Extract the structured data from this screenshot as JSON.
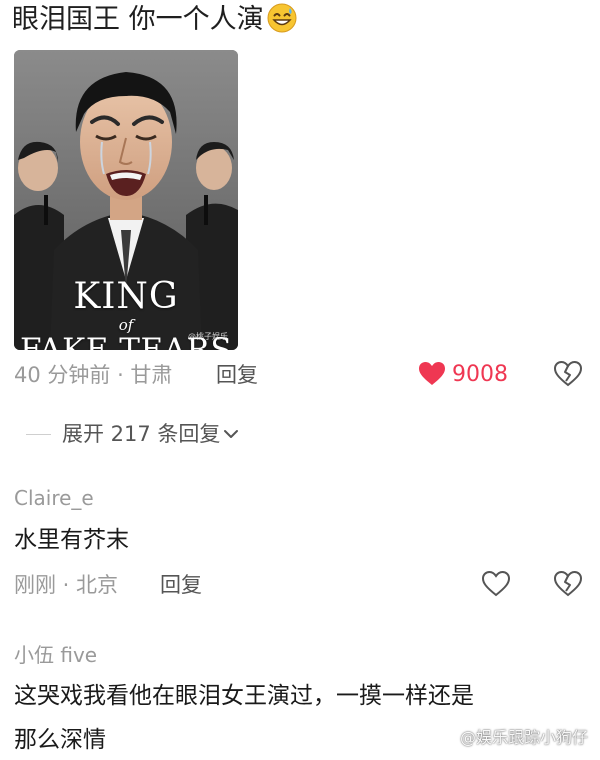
{
  "top_comment": {
    "text": "眼泪国王  你一个人演",
    "emoji": "grinning-sweat-emoji",
    "image": {
      "title_line1": "KING",
      "title_line2": "of",
      "title_line3": "FAKE TEARS",
      "watermark": "@桃子娱乐"
    },
    "meta": "40 分钟前 · 甘肃",
    "reply_label": "回复",
    "like_count": "9008",
    "liked": true,
    "like_color": "#ef3752",
    "expand_label": "展开 217 条回复"
  },
  "comments": [
    {
      "username": "Claire_e",
      "text": "水里有芥末",
      "meta": "刚刚 · 北京",
      "reply_label": "回复"
    },
    {
      "username": "小伍 five",
      "text_line1": "这哭戏我看他在眼泪女王演过，一摸一样还是",
      "text_line2": "那么深情"
    }
  ],
  "watermark": "@娱乐跟踪小狗仔"
}
